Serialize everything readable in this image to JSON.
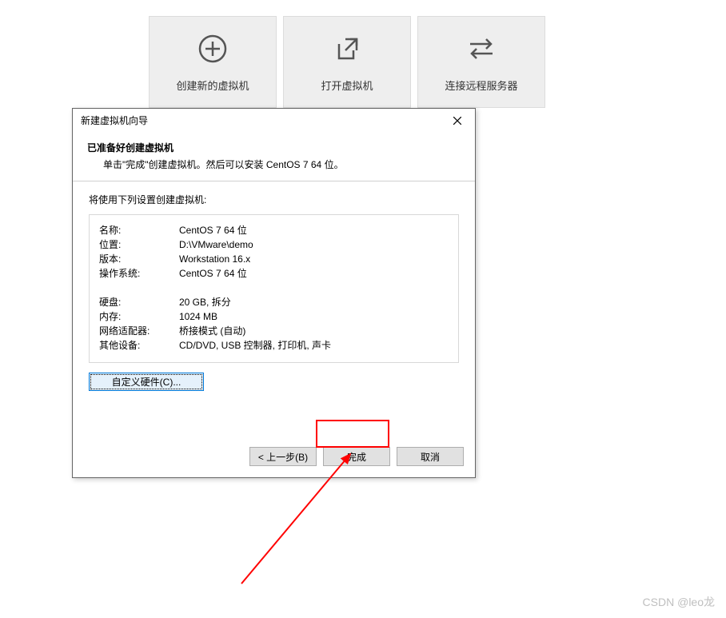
{
  "home": {
    "tile1": "创建新的虚拟机",
    "tile2": "打开虚拟机",
    "tile3": "连接远程服务器"
  },
  "dialog": {
    "title": "新建虚拟机向导",
    "heading": "已准备好创建虚拟机",
    "subtext": "单击\"完成\"创建虚拟机。然后可以安装 CentOS 7 64 位。",
    "body_lead": "将使用下列设置创建虚拟机:",
    "rows": {
      "name_label": "名称:",
      "name_value": "CentOS 7 64 位",
      "location_label": "位置:",
      "location_value": "D:\\VMware\\demo",
      "version_label": "版本:",
      "version_value": "Workstation 16.x",
      "os_label": "操作系统:",
      "os_value": "CentOS 7 64 位",
      "disk_label": "硬盘:",
      "disk_value": "20 GB, 拆分",
      "memory_label": "内存:",
      "memory_value": "1024 MB",
      "network_label": "网络适配器:",
      "network_value": "桥接模式 (自动)",
      "other_label": "其他设备:",
      "other_value": "CD/DVD, USB 控制器, 打印机, 声卡"
    },
    "customize_btn": "自定义硬件(C)...",
    "back_btn": "< 上一步(B)",
    "finish_btn": "完成",
    "cancel_btn": "取消"
  },
  "watermark": "CSDN @leo龙"
}
